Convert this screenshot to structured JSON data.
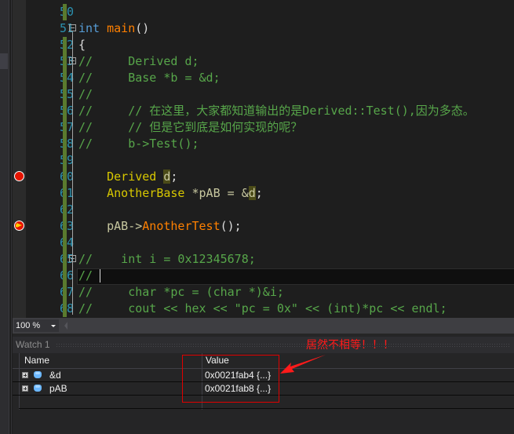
{
  "editor": {
    "lines": [
      {
        "num": "50",
        "tokens": []
      },
      {
        "num": "51",
        "tokens": [
          {
            "t": "int",
            "c": "kw"
          },
          {
            "t": " ",
            "c": ""
          },
          {
            "t": "main",
            "c": "fn"
          },
          {
            "t": "()",
            "c": ""
          }
        ]
      },
      {
        "num": "52",
        "tokens": [
          {
            "t": "{",
            "c": ""
          }
        ]
      },
      {
        "num": "53",
        "tokens": [
          {
            "t": "//     Derived d;",
            "c": "cm"
          }
        ]
      },
      {
        "num": "54",
        "tokens": [
          {
            "t": "//     Base *b = &d;",
            "c": "cm"
          }
        ]
      },
      {
        "num": "55",
        "tokens": [
          {
            "t": "//",
            "c": "cm"
          }
        ]
      },
      {
        "num": "56",
        "tokens": [
          {
            "t": "//     // 在这里，大家都知道输出的是Derived::Test(),因为多态。",
            "c": "cm"
          }
        ]
      },
      {
        "num": "57",
        "tokens": [
          {
            "t": "//     // 但是它到底是如何实现的呢？",
            "c": "cm"
          }
        ]
      },
      {
        "num": "58",
        "tokens": [
          {
            "t": "//     b->Test();",
            "c": "cm"
          }
        ]
      },
      {
        "num": "59",
        "tokens": []
      },
      {
        "num": "60",
        "tokens": [
          {
            "t": "    ",
            "c": ""
          },
          {
            "t": "Derived",
            "c": "ty"
          },
          {
            "t": " ",
            "c": ""
          },
          {
            "t": "d",
            "c": "var hl"
          },
          {
            "t": ";",
            "c": ""
          }
        ]
      },
      {
        "num": "61",
        "tokens": [
          {
            "t": "    ",
            "c": ""
          },
          {
            "t": "AnotherBase",
            "c": "ty"
          },
          {
            "t": " *pAB = &",
            "c": "var"
          },
          {
            "t": "d",
            "c": "var hl"
          },
          {
            "t": ";",
            "c": ""
          }
        ]
      },
      {
        "num": "62",
        "tokens": []
      },
      {
        "num": "63",
        "tokens": [
          {
            "t": "    ",
            "c": ""
          },
          {
            "t": "pAB->",
            "c": "var"
          },
          {
            "t": "AnotherTest",
            "c": "fn"
          },
          {
            "t": "();",
            "c": ""
          }
        ]
      },
      {
        "num": "64",
        "tokens": []
      },
      {
        "num": "65",
        "tokens": [
          {
            "t": "//    int i = 0x12345678;",
            "c": "cm"
          }
        ]
      },
      {
        "num": "66",
        "tokens": [
          {
            "t": "// ",
            "c": "cm"
          }
        ]
      },
      {
        "num": "67",
        "tokens": [
          {
            "t": "//     char *pc = (char *)&i;",
            "c": "cm"
          }
        ]
      },
      {
        "num": "68",
        "tokens": [
          {
            "t": "//     cout << hex << \"pc = 0x\" << (int)*pc << endl;",
            "c": "cm"
          }
        ]
      }
    ],
    "breakpoint_line": "60",
    "current_statement_line": "63",
    "caret_line": "66"
  },
  "zoombar": {
    "zoom_level": "100 %"
  },
  "watch": {
    "title": "Watch 1",
    "columns": {
      "name": "Name",
      "value": "Value"
    },
    "rows": [
      {
        "name": "&d",
        "value": "0x0021fab4 {...}"
      },
      {
        "name": "pAB",
        "value": "0x0021fab8 {...}"
      }
    ]
  },
  "annotation": {
    "text": "居然不相等！！！",
    "color": "#ff1a1a"
  }
}
